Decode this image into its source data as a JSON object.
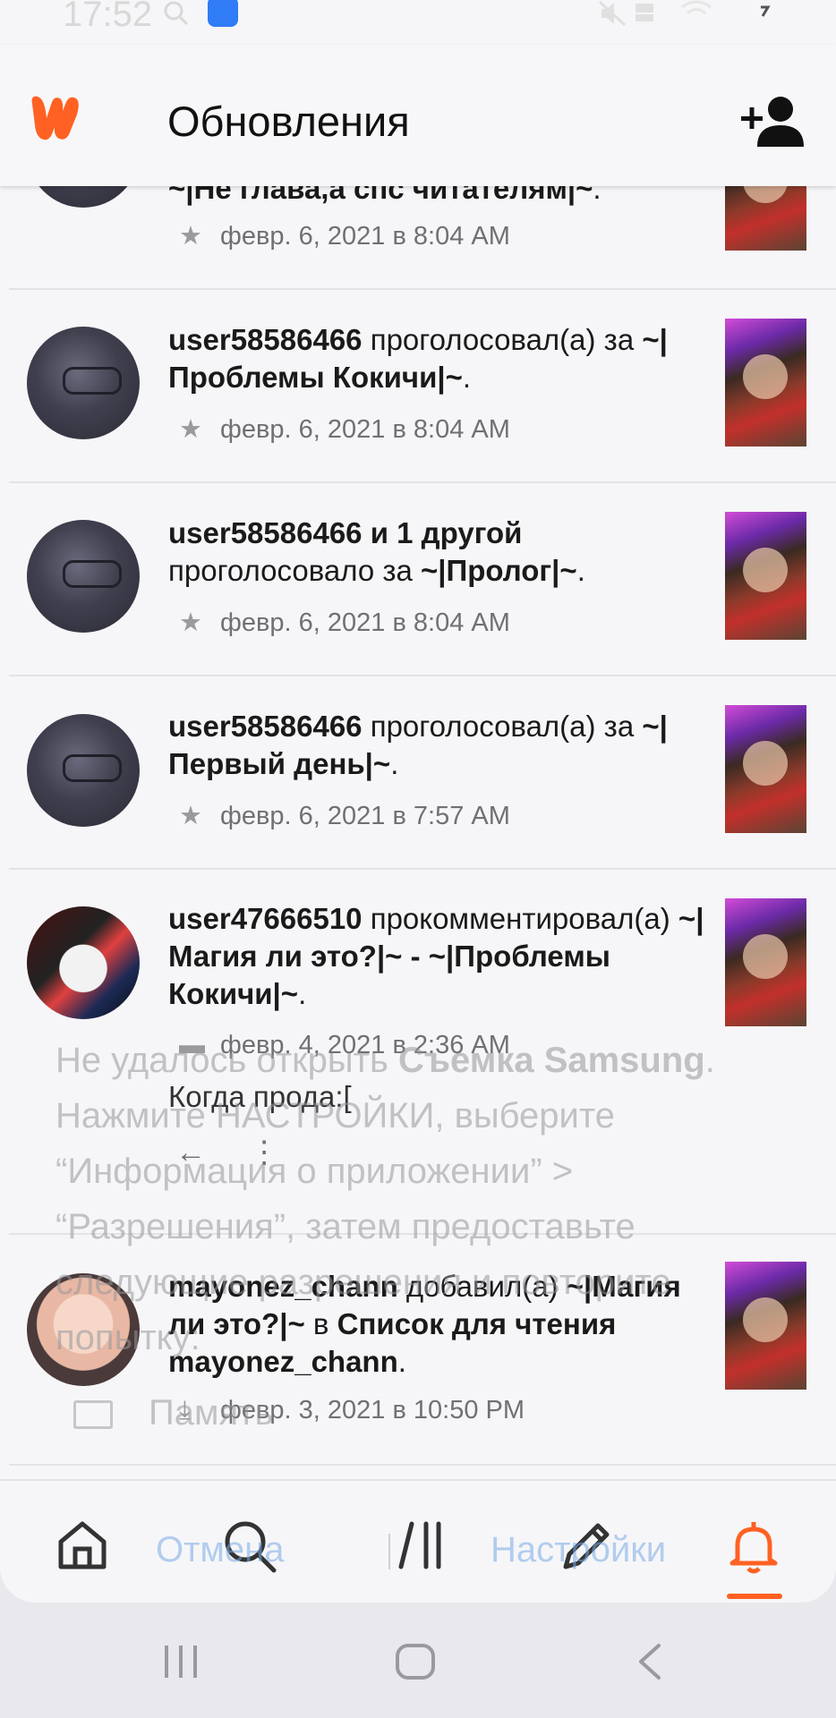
{
  "status_bar": {
    "time": "17:52"
  },
  "header": {
    "title": "Обновления"
  },
  "notifications": [
    {
      "text_html": "<b>~|Не глава,а спс читателям|~</b>.",
      "time": "февр. 6, 2021 в 8:04 AM",
      "type": "vote"
    },
    {
      "text_html": "<b>user58586466</b> проголосовал(а) за <b>~|Проблемы Кокичи|~</b>.",
      "time": "февр. 6, 2021 в 8:04 AM",
      "type": "vote"
    },
    {
      "text_html": "<b>user58586466 и 1 другой</b> проголосовало за <b>~|Пролог|~</b>.",
      "time": "февр. 6, 2021 в 8:04 AM",
      "type": "vote"
    },
    {
      "text_html": "<b>user58586466</b> проголосовал(а) за <b>~|Первый день|~</b>.",
      "time": "февр. 6, 2021 в 7:57 AM",
      "type": "vote"
    },
    {
      "text_html": "<b>user47666510</b> прокомментировал(а) <b>~|Магия ли это?|~ - ~|Проблемы Кокичи|~</b>.",
      "time": "февр. 4, 2021 в 2:36 AM",
      "type": "comment",
      "comment": "Когда прода:["
    },
    {
      "text_html": "<b>mayonez_chann</b> добавил(а) <b>~|Магия ли это?|~</b> в <b>Список для чтения mayonez_chann</b>.",
      "time": "февр. 3, 2021 в 10:50 PM",
      "type": "list"
    }
  ],
  "toast_overlay": {
    "message_html": "Не удалось открыть <b>Съемка Samsung</b>. Нажмите НАСТРОЙКИ, выберите “Информация о приложении” > “Разрешения”, затем предоставьте следующие разрешения и повторите попытку:",
    "permission": "Память",
    "cancel": "Отмена",
    "settings": "Настройки"
  },
  "bottom_nav": {
    "active": "notifications"
  },
  "colors": {
    "brand": "#ff6122",
    "background": "#f6f6f8"
  }
}
